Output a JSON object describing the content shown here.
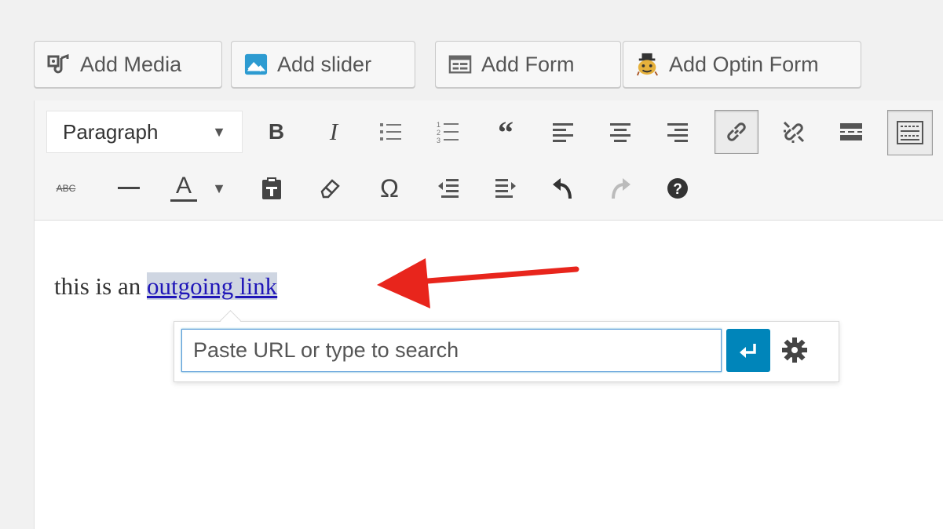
{
  "media_buttons": [
    {
      "label": "Add Media",
      "icon": "media-icon"
    },
    {
      "label": "Add slider",
      "icon": "slider-icon"
    },
    {
      "label": "Add Form",
      "icon": "form-icon"
    },
    {
      "label": "Add Optin Form",
      "icon": "optin-icon"
    }
  ],
  "toolbar": {
    "format_select": {
      "value": "Paragraph"
    },
    "row1_icons": [
      "bold-icon",
      "italic-icon",
      "bullet-list-icon",
      "numbered-list-icon",
      "blockquote-icon",
      "align-left-icon",
      "align-center-icon",
      "align-right-icon",
      "link-icon",
      "unlink-icon",
      "read-more-icon",
      "toolbar-toggle-icon"
    ],
    "row2_icons": [
      "strikethrough-icon",
      "horizontal-line-icon",
      "text-color-icon",
      "paste-text-icon",
      "clear-formatting-icon",
      "special-character-icon",
      "outdent-icon",
      "indent-icon",
      "undo-icon",
      "redo-icon",
      "help-icon"
    ],
    "text_color_letter": "A",
    "strike_label": "ABC",
    "bold_label": "B",
    "italic_label": "I",
    "omega": "Ω"
  },
  "content": {
    "text_before": "this is an ",
    "link_text": "outgoing link"
  },
  "link_popup": {
    "placeholder": "Paste URL or type to search",
    "value": ""
  },
  "colors": {
    "accent": "#0085ba",
    "arrow": "#e8251c",
    "link": "#1f16b8"
  }
}
